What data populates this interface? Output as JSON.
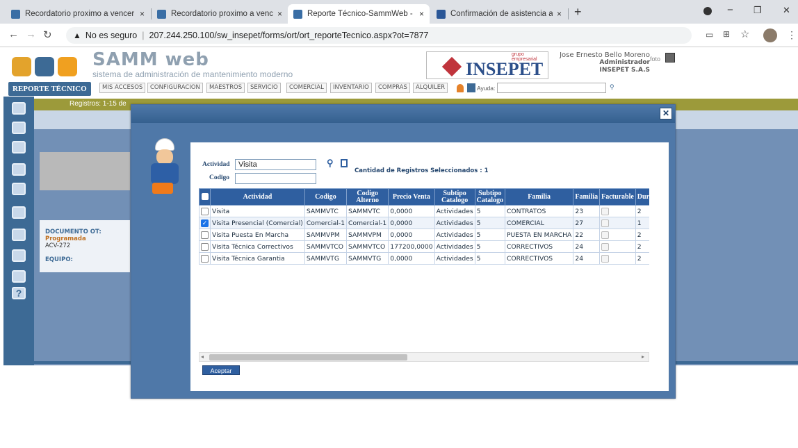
{
  "browser": {
    "tabs": [
      {
        "title": "Recordatorio proximo a vencer",
        "close": "×",
        "fav": "#3a6ea5"
      },
      {
        "title": "Recordatorio proximo a vencer",
        "close": "×",
        "fav": "#3a6ea5"
      },
      {
        "title": "Reporte Técnico-SammWeb - sist",
        "close": "×",
        "fav": "#3a6ea5"
      },
      {
        "title": "Confirmación de asistencia al eve",
        "close": "×",
        "fav": "#2b5797"
      }
    ],
    "new_tab": "+",
    "security": "No es seguro",
    "url": "207.244.250.100/sw_insepet/forms/ort/ort_reporteTecnico.aspx?ot=7877",
    "window_min": "−",
    "window_max": "❐",
    "window_close": "✕"
  },
  "app": {
    "logo_title": "SAMM web",
    "logo_subtitle": "sistema de administración de mantenimiento moderno",
    "brand_small": "grupo empresarial",
    "brand": "INSEPET",
    "user_name": "Jose Ernesto Bello Moreno",
    "user_role": "Administrador",
    "user_company": "INSEPET S.A.S",
    "user_photo_alt": "foto",
    "section_title": "REPORTE TÉCNICO",
    "menu": [
      "MIS ACCESOS",
      "CONFIGURACION",
      "MAESTROS",
      "SERVICIO",
      "COMERCIAL",
      "INVENTARIO",
      "COMPRAS",
      "ALQUILER"
    ],
    "help_label": "Ayuda:",
    "records_label": "Registros: 1-15 de",
    "doc_label": "DOCUMENTO OT:",
    "doc_status": "Programada",
    "doc_code": "ACV-272",
    "equipo_label": "EQUIPO:"
  },
  "dialog": {
    "close": "✕",
    "actividad_label": "Actividad",
    "actividad_value": "Visita",
    "codigo_label": "Codigo",
    "codigo_value": "",
    "selected_count": "Cantidad de Registros Seleccionados : 1",
    "accept": "Aceptar",
    "columns": [
      "Actividad",
      "Codigo",
      "Codigo Alterno",
      "Precio Venta",
      "Subtipo Catalogo",
      "Subtipo Catalogo",
      "Familia",
      "Familia",
      "Facturable",
      "Duracion"
    ],
    "rows": [
      {
        "checked": false,
        "actividad": "Visita",
        "codigo": "SAMMVTC",
        "alterno": "SAMMVTC",
        "precio": "0,0000",
        "subtipo1": "Actividades",
        "subtipo2": "5",
        "familia": "CONTRATOS",
        "familia_id": "23",
        "duracion": "2"
      },
      {
        "checked": true,
        "actividad": "Visita Presencial (Comercial)",
        "codigo": "Comercial-1",
        "alterno": "Comercial-1",
        "precio": "0,0000",
        "subtipo1": "Actividades",
        "subtipo2": "5",
        "familia": "COMERCIAL",
        "familia_id": "27",
        "duracion": "1"
      },
      {
        "checked": false,
        "actividad": "Visita Puesta En Marcha",
        "codigo": "SAMMVPM",
        "alterno": "SAMMVPM",
        "precio": "0,0000",
        "subtipo1": "Actividades",
        "subtipo2": "5",
        "familia": "PUESTA EN MARCHA",
        "familia_id": "22",
        "duracion": "2"
      },
      {
        "checked": false,
        "actividad": "Visita Técnica Correctivos",
        "codigo": "SAMMVTCO",
        "alterno": "SAMMVTCO",
        "precio": "177200,0000",
        "subtipo1": "Actividades",
        "subtipo2": "5",
        "familia": "CORRECTIVOS",
        "familia_id": "24",
        "duracion": "2"
      },
      {
        "checked": false,
        "actividad": "Visita Técnica Garantia",
        "codigo": "SAMMVTG",
        "alterno": "SAMMVTG",
        "precio": "0,0000",
        "subtipo1": "Actividades",
        "subtipo2": "5",
        "familia": "CORRECTIVOS",
        "familia_id": "24",
        "duracion": "2"
      }
    ]
  }
}
